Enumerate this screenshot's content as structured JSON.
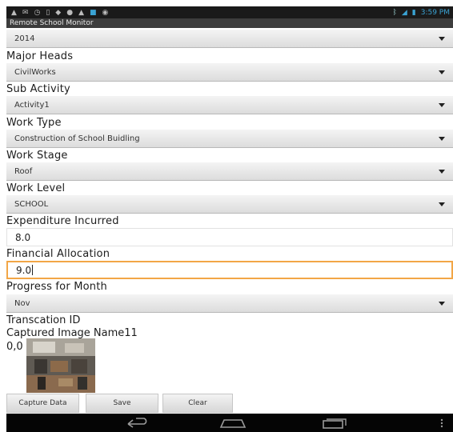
{
  "status_bar": {
    "time": "3:59 PM",
    "notification_icons": [
      "notification-icon",
      "mail-icon",
      "clock-icon",
      "tablet-icon",
      "bell-icon",
      "user-icon",
      "app-icon",
      "settings-icon",
      "camera-icon"
    ],
    "right_icons": [
      "bluetooth-icon",
      "wifi-icon",
      "battery-icon"
    ]
  },
  "app": {
    "title": "Remote School Monitor"
  },
  "form": {
    "year": {
      "value": "2014"
    },
    "major_heads": {
      "label": "Major Heads",
      "value": "CivilWorks"
    },
    "sub_activity": {
      "label": "Sub Activity",
      "value": "Activity1"
    },
    "work_type": {
      "label": "Work Type",
      "value": "Construction of School Buidling"
    },
    "work_stage": {
      "label": "Work Stage",
      "value": "Roof"
    },
    "work_level": {
      "label": "Work Level",
      "value": "SCHOOL"
    },
    "expenditure": {
      "label": "Expenditure Incurred",
      "value": "8.0"
    },
    "financial_allocation": {
      "label": "Financial Allocation",
      "value": "9.0"
    },
    "progress": {
      "label": "Progress for Month",
      "value": "Nov"
    },
    "transaction_id_label": "Transcation ID",
    "captured_image_label": "Captured Image Name11",
    "coordinates": "0,0"
  },
  "buttons": {
    "capture": "Capture Data",
    "save": "Save",
    "clear": "Clear"
  },
  "nav": [
    "back-icon",
    "home-icon",
    "recent-apps-icon",
    "overflow-menu-icon"
  ],
  "colors": {
    "focus_border": "#f2a646",
    "status_time": "#3aa3d4",
    "title_bar": "#3d3d3d"
  }
}
